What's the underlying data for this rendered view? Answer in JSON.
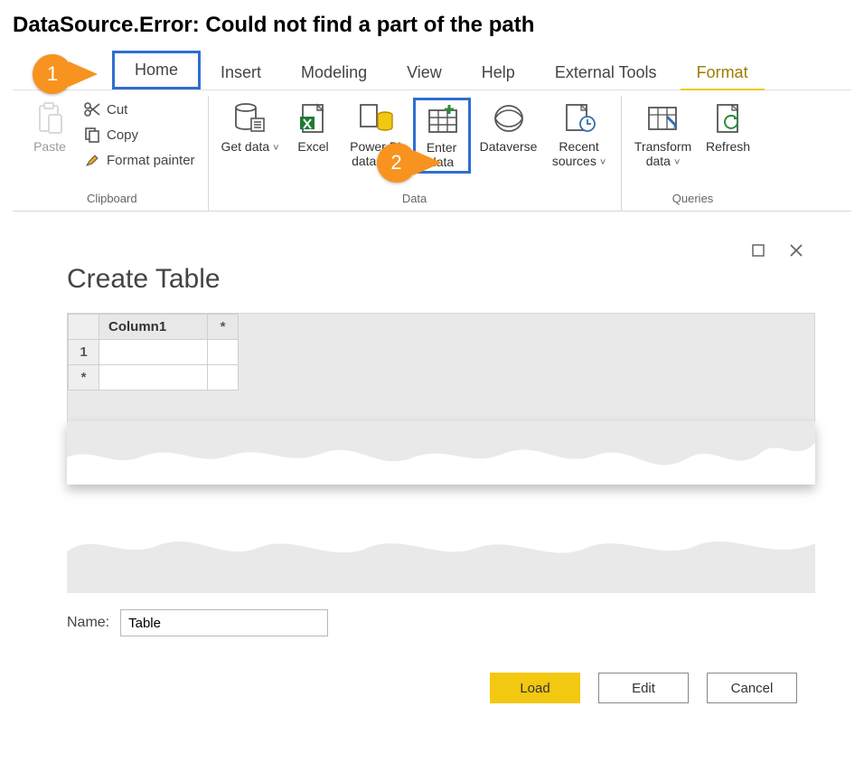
{
  "heading": "DataSource.Error: Could not find a part of the path",
  "callouts": {
    "one": "1",
    "two": "2"
  },
  "tabs": {
    "home": "Home",
    "insert": "Insert",
    "modeling": "Modeling",
    "view": "View",
    "help": "Help",
    "external": "External Tools",
    "format": "Format"
  },
  "clipboard": {
    "paste": "Paste",
    "cut": "Cut",
    "copy": "Copy",
    "format_painter": "Format painter",
    "group": "Clipboard"
  },
  "data_group": {
    "get_data": "Get data",
    "excel": "Excel",
    "powerbi": "Power BI datasets",
    "enter_data": "Enter data",
    "dataverse": "Dataverse",
    "recent": "Recent sources",
    "group": "Data"
  },
  "queries_group": {
    "transform": "Transform data",
    "refresh": "Refresh",
    "group": "Queries"
  },
  "dialog": {
    "title": "Create Table",
    "column_header": "Column1",
    "row1": "1",
    "star": "*",
    "name_label": "Name:",
    "name_value": "Table",
    "load": "Load",
    "edit": "Edit",
    "cancel": "Cancel"
  }
}
